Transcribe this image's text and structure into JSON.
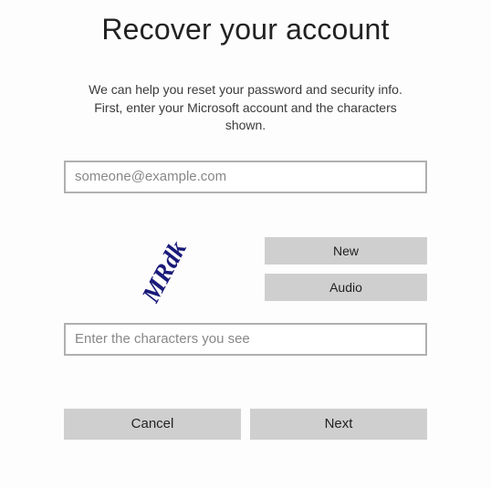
{
  "header": {
    "title": "Recover your account"
  },
  "intro": "We can help you reset your password and security info. First, enter your Microsoft account and the characters shown.",
  "form": {
    "email_placeholder": "someone@example.com",
    "captcha_placeholder": "Enter the characters you see",
    "captcha_text": "MRdk"
  },
  "captcha_buttons": {
    "new_label": "New",
    "audio_label": "Audio"
  },
  "actions": {
    "cancel_label": "Cancel",
    "next_label": "Next"
  }
}
